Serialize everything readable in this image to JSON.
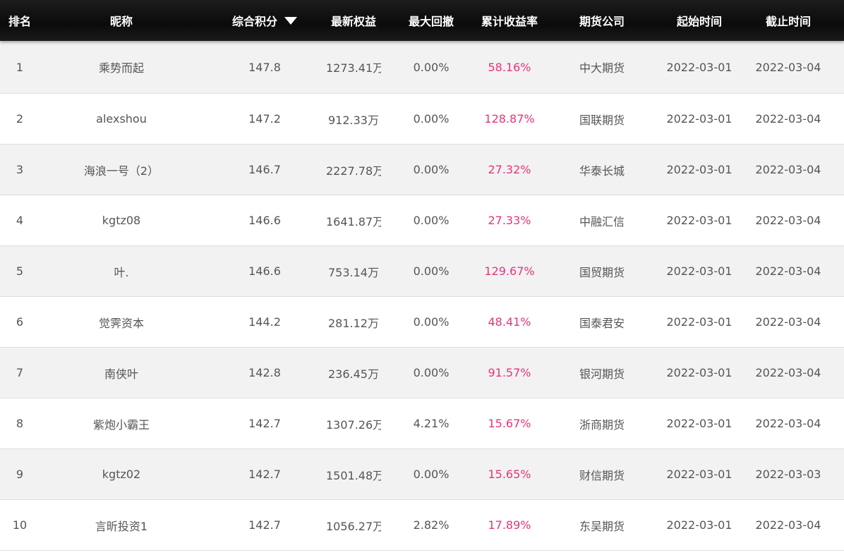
{
  "colors": {
    "header_bg": "#0b0b0b",
    "header_text": "#ffffff",
    "row_alt_bg": "#f2f2f2",
    "text": "#555555",
    "return_accent": "#e8337c"
  },
  "header": {
    "rank": "排名",
    "nickname": "昵称",
    "score": "综合积分",
    "score_sort_icon": "caret-down-icon",
    "equity": "最新权益",
    "max_drawdown": "最大回撤",
    "cum_return": "累计收益率",
    "firm": "期货公司",
    "start_time": "起始时间",
    "end_time": "截止时间"
  },
  "rows": [
    {
      "rank": "1",
      "nickname": "乘势而起",
      "score": "147.8",
      "equity": "1273.41万",
      "max_drawdown": "0.00%",
      "cum_return": "58.16%",
      "firm": "中大期货",
      "start_time": "2022-03-01",
      "end_time": "2022-03-04"
    },
    {
      "rank": "2",
      "nickname": "alexshou",
      "score": "147.2",
      "equity": "912.33万",
      "max_drawdown": "0.00%",
      "cum_return": "128.87%",
      "firm": "国联期货",
      "start_time": "2022-03-01",
      "end_time": "2022-03-04"
    },
    {
      "rank": "3",
      "nickname": "海浪一号（2）",
      "score": "146.7",
      "equity": "2227.78万",
      "max_drawdown": "0.00%",
      "cum_return": "27.32%",
      "firm": "华泰长城",
      "start_time": "2022-03-01",
      "end_time": "2022-03-04"
    },
    {
      "rank": "4",
      "nickname": "kgtz08",
      "score": "146.6",
      "equity": "1641.87万",
      "max_drawdown": "0.00%",
      "cum_return": "27.33%",
      "firm": "中融汇信",
      "start_time": "2022-03-01",
      "end_time": "2022-03-04"
    },
    {
      "rank": "5",
      "nickname": "叶.",
      "score": "146.6",
      "equity": "753.14万",
      "max_drawdown": "0.00%",
      "cum_return": "129.67%",
      "firm": "国贸期货",
      "start_time": "2022-03-01",
      "end_time": "2022-03-04"
    },
    {
      "rank": "6",
      "nickname": "觉霁资本",
      "score": "144.2",
      "equity": "281.12万",
      "max_drawdown": "0.00%",
      "cum_return": "48.41%",
      "firm": "国泰君安",
      "start_time": "2022-03-01",
      "end_time": "2022-03-04"
    },
    {
      "rank": "7",
      "nickname": "南侠叶",
      "score": "142.8",
      "equity": "236.45万",
      "max_drawdown": "0.00%",
      "cum_return": "91.57%",
      "firm": "银河期货",
      "start_time": "2022-03-01",
      "end_time": "2022-03-04"
    },
    {
      "rank": "8",
      "nickname": "紫炮小霸王",
      "score": "142.7",
      "equity": "1307.26万",
      "max_drawdown": "4.21%",
      "cum_return": "15.67%",
      "firm": "浙商期货",
      "start_time": "2022-03-01",
      "end_time": "2022-03-04"
    },
    {
      "rank": "9",
      "nickname": "kgtz02",
      "score": "142.7",
      "equity": "1501.48万",
      "max_drawdown": "0.00%",
      "cum_return": "15.65%",
      "firm": "财信期货",
      "start_time": "2022-03-01",
      "end_time": "2022-03-03"
    },
    {
      "rank": "10",
      "nickname": "言昕投资1",
      "score": "142.7",
      "equity": "1056.27万",
      "max_drawdown": "2.82%",
      "cum_return": "17.89%",
      "firm": "东吴期货",
      "start_time": "2022-03-01",
      "end_time": "2022-03-04"
    }
  ]
}
